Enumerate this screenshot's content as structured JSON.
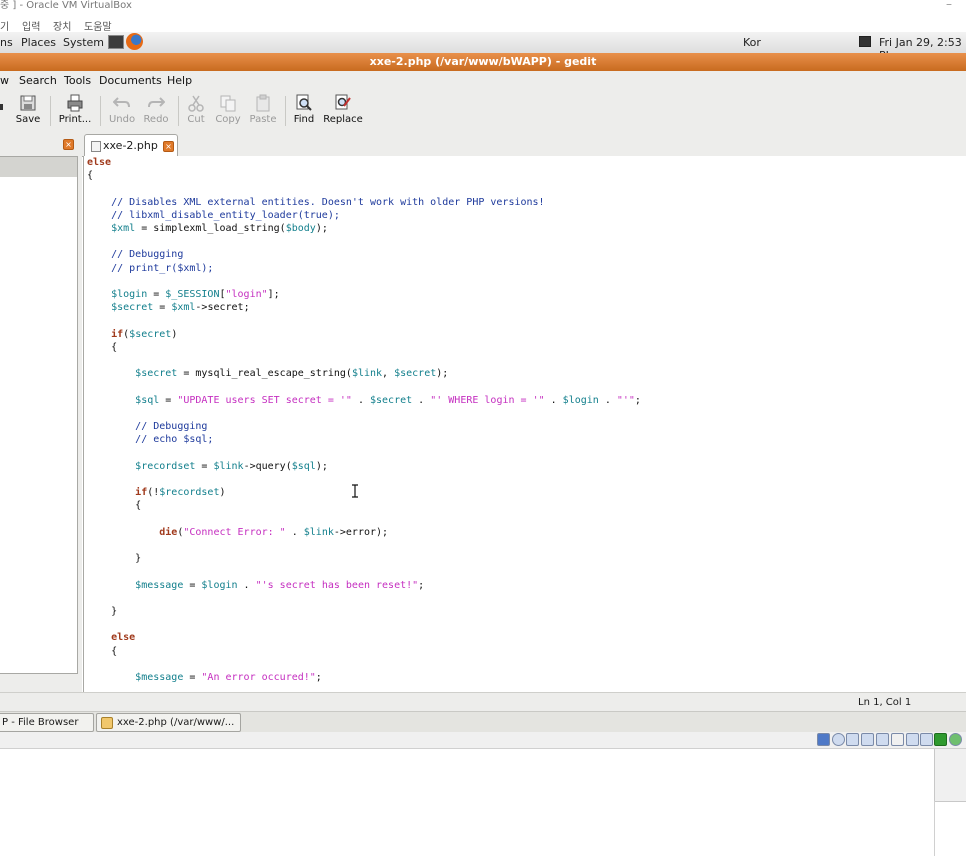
{
  "host_window": {
    "title": "중 ] - Oracle VM VirtualBox",
    "menu": [
      "기",
      "입력",
      "장치",
      "도움말"
    ],
    "minimize": "–"
  },
  "panel": {
    "items": [
      "ns",
      "Places",
      "System"
    ],
    "input_method": "Kor",
    "clock": "Fri Jan 29,  2:53 PI"
  },
  "gedit": {
    "title": "xxe-2.php (/var/www/bWAPP) - gedit",
    "menu": [
      "w",
      "Search",
      "Tools",
      "Documents",
      "Help"
    ],
    "toolbar": {
      "save": "Save",
      "print": "Print...",
      "undo": "Undo",
      "redo": "Redo",
      "cut": "Cut",
      "copy": "Copy",
      "paste": "Paste",
      "find": "Find",
      "replace": "Replace"
    },
    "tab": "xxe-2.php",
    "status_position": "Ln 1, Col 1"
  },
  "code_lines": [
    "else",
    "{",
    "",
    "    // Disables XML external entities. Doesn't work with older PHP versions!",
    "    // libxml_disable_entity_loader(true);",
    "    $xml = simplexml_load_string($body);",
    "",
    "    // Debugging",
    "    // print_r($xml);",
    "",
    "    $login = $_SESSION[\"login\"];",
    "    $secret = $xml->secret;",
    "",
    "    if($secret)",
    "    {",
    "",
    "        $secret = mysqli_real_escape_string($link, $secret);",
    "",
    "        $sql = \"UPDATE users SET secret = '\" . $secret . \"' WHERE login = '\" . $login . \"'\";",
    "",
    "        // Debugging",
    "        // echo $sql;",
    "",
    "        $recordset = $link->query($sql);",
    "",
    "        if(!$recordset)",
    "        {",
    "",
    "            die(\"Connect Error: \" . $link->error);",
    "",
    "        }",
    "",
    "        $message = $login . \"'s secret has been reset!\";",
    "",
    "    }",
    "",
    "    else",
    "    {",
    "",
    "        $message = \"An error occured!\";"
  ],
  "taskbar": {
    "file_browser": "P - File Browser",
    "editor": "xxe-2.php (/var/www/..."
  }
}
